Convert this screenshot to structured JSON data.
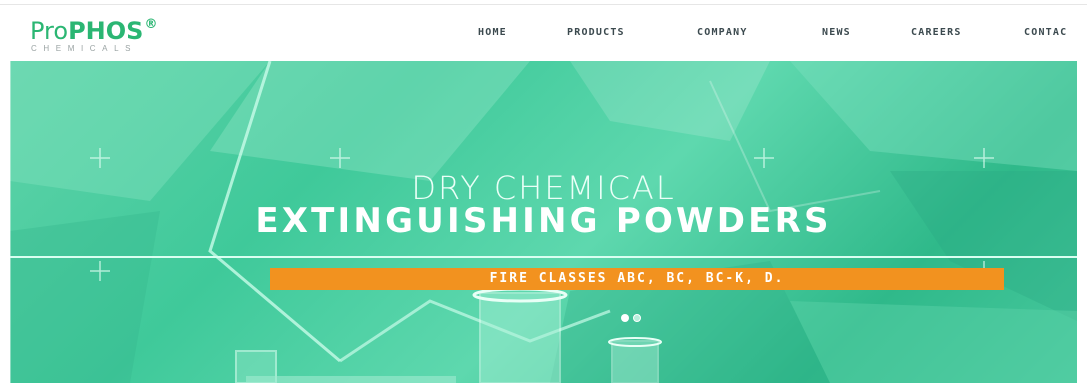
{
  "logo": {
    "name_light": "Pro",
    "name_bold": "PHOS",
    "registered_mark": "®",
    "tagline": "CHEMICALS"
  },
  "nav": {
    "items": [
      {
        "label": "HOME"
      },
      {
        "label": "PRODUCTS"
      },
      {
        "label": "COMPANY"
      },
      {
        "label": "NEWS"
      },
      {
        "label": "CAREERS"
      },
      {
        "label": "CONTAC"
      }
    ]
  },
  "hero": {
    "headline_light": "DRY CHEMICAL",
    "headline_bold": "EXTINGUISHING POWDERS",
    "banner_text": "FIRE CLASSES ABC, BC, BC-K, D.",
    "slides": {
      "count": 2,
      "active": 1
    }
  },
  "colors": {
    "brand_green": "#2bb673",
    "banner_orange": "#f2921f",
    "nav_text": "#3c4a4f"
  }
}
